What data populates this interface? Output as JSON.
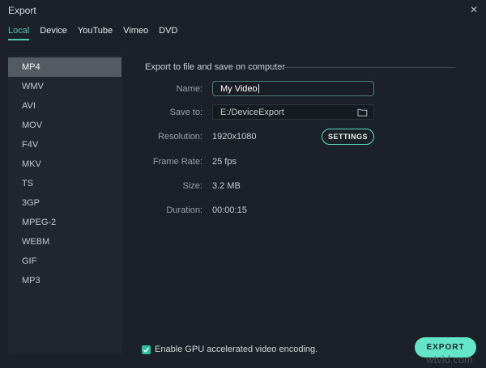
{
  "window": {
    "title": "Export",
    "close_icon": "✕"
  },
  "tabs": [
    {
      "label": "Local",
      "active": true
    },
    {
      "label": "Device",
      "active": false
    },
    {
      "label": "YouTube",
      "active": false
    },
    {
      "label": "Vimeo",
      "active": false
    },
    {
      "label": "DVD",
      "active": false
    }
  ],
  "sidebar": {
    "selected": "MP4",
    "formats": [
      "MP4",
      "WMV",
      "AVI",
      "MOV",
      "F4V",
      "MKV",
      "TS",
      "3GP",
      "MPEG-2",
      "WEBM",
      "GIF",
      "MP3"
    ]
  },
  "main": {
    "section_title": "Export to file and save on computer",
    "fields": {
      "name": {
        "label": "Name:",
        "value": "My Video"
      },
      "save_to": {
        "label": "Save to:",
        "value": "E:/DeviceExport"
      },
      "resolution": {
        "label": "Resolution:",
        "value": "1920x1080",
        "settings_label": "SETTINGS"
      },
      "frame_rate": {
        "label": "Frame Rate:",
        "value": "25 fps"
      },
      "size": {
        "label": "Size:",
        "value": "3.2 MB"
      },
      "duration": {
        "label": "Duration:",
        "value": "00:00:15"
      }
    }
  },
  "footer": {
    "gpu_checkbox": {
      "label": "Enable GPU accelerated video encoding.",
      "checked": true
    },
    "export_label": "EXPORT"
  },
  "watermark": "wtvid.com",
  "colors": {
    "background": "#1c2129",
    "sidebar": "#22272f",
    "selected_row": "#545a62",
    "accent_teal": "#55dec0",
    "export_button": "#63e6c8",
    "checkbox": "#25c29b"
  }
}
